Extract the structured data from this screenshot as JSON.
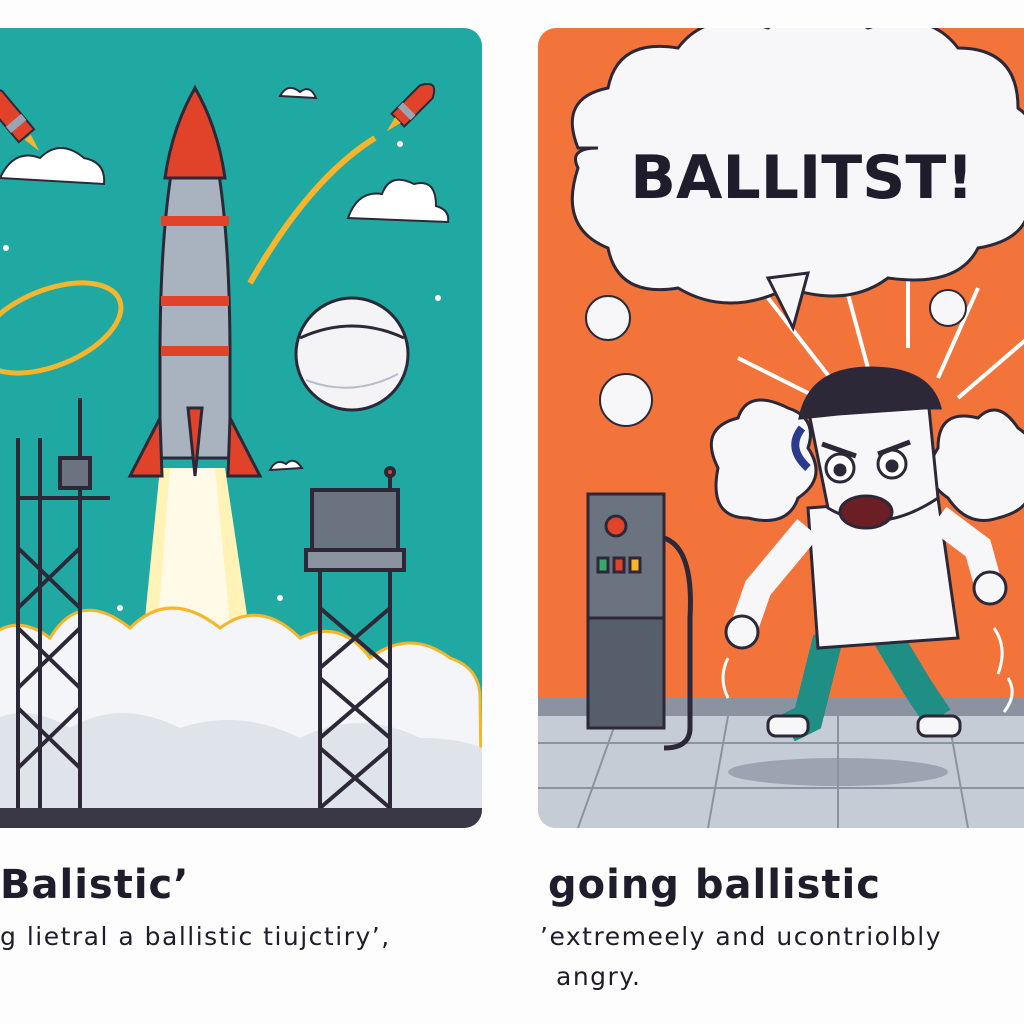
{
  "left_caption": {
    "title": "Balistic’",
    "subtitle": "g lietral a ballistic tiujctiry’,"
  },
  "right_caption": {
    "title": "going ballistic",
    "subtitle_line1": "’extremeely and ucontriolbly",
    "subtitle_line2": "angry."
  },
  "speech_bubble": {
    "text": "BALLITST!"
  },
  "colors": {
    "left_sky": "#1fa9a2",
    "right_wall": "#f3743a",
    "rocket_red": "#e0432a",
    "outline": "#2d2838"
  },
  "icons": [
    "rocket",
    "small-rocket",
    "launch-tower",
    "baseball",
    "smoke-cloud",
    "angry-man",
    "fuel-pump",
    "speech-bubble"
  ]
}
